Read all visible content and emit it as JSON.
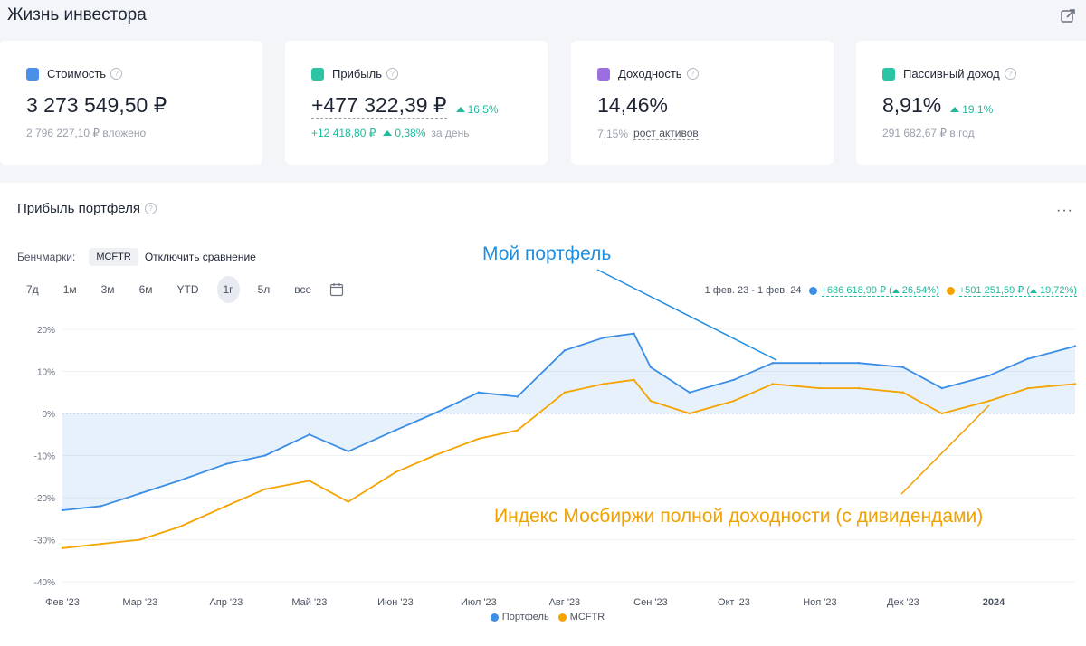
{
  "page_title": "Жизнь инвестора",
  "icons": {
    "share": "share-icon",
    "question": "?"
  },
  "cards": [
    {
      "label": "Стоимость",
      "value": "3 273 549,50 ₽",
      "change": "",
      "sub": "2 796 227,10 ₽ вложено",
      "sub_change": "",
      "sub_tail": "",
      "icon_color": "#4a8fe8"
    },
    {
      "label": "Прибыль",
      "value": "+477 322,39 ₽",
      "change": "16,5%",
      "sub": "+12 418,80 ₽",
      "sub_change": "0,38%",
      "sub_tail": "за день",
      "icon_color": "#2bc5a5"
    },
    {
      "label": "Доходность",
      "value": "14,46%",
      "change": "",
      "sub": "7,15%",
      "sub_change": "",
      "sub_tail": "рост активов",
      "icon_color": "#9b6fe0"
    },
    {
      "label": "Пассивный доход",
      "value": "8,91%",
      "change": "19,1%",
      "sub": "291 682,67 ₽ в год",
      "sub_change": "",
      "sub_tail": "",
      "icon_color": "#2bc5a5"
    }
  ],
  "chart_panel": {
    "title": "Прибыль портфеля",
    "benchmarks_label": "Бенчмарки:",
    "benchmark_chip": "MCFTR",
    "disable_compare": "Отключить сравнение",
    "periods": [
      "7д",
      "1м",
      "3м",
      "6м",
      "YTD",
      "1г",
      "5л",
      "все"
    ],
    "active_period": "1г",
    "range": "1 фев. 23 - 1 фев. 24",
    "portfolio_gain": "+686 618,99 ₽ (",
    "portfolio_pct": "26,54%)",
    "bench_gain": "+501 251,59 ₽ (",
    "bench_pct": "19,72%)",
    "annotation_portfolio": "Мой портфель",
    "annotation_index": "Индекс Мосбиржи полной доходности (с дивидендами)",
    "more_icon": "···"
  },
  "colors": {
    "portfolio": "#3b8ee6",
    "mcftr": "#f5a300",
    "green": "#1fb99b"
  },
  "chart_data": {
    "type": "line",
    "x_tick_labels": [
      "Фев '23",
      "Мар '23",
      "Апр '23",
      "Май '23",
      "Июн '23",
      "Июл '23",
      "Авг '23",
      "Сен '23",
      "Окт '23",
      "Ноя '23",
      "Дек '23",
      "2024"
    ],
    "y_tick_labels": [
      "20%",
      "10%",
      "0%",
      "-10%",
      "-20%",
      "-30%",
      "-40%"
    ],
    "ylim": [
      -40,
      20
    ],
    "grid": "y",
    "legend_position": "bottom",
    "series": [
      {
        "name": "Портфель",
        "color": "#3b8ee6",
        "x": [
          "2023-02-01",
          "2023-02-15",
          "2023-03-01",
          "2023-03-15",
          "2023-04-01",
          "2023-04-15",
          "2023-05-01",
          "2023-05-15",
          "2023-06-01",
          "2023-06-15",
          "2023-07-01",
          "2023-07-15",
          "2023-08-01",
          "2023-08-15",
          "2023-08-26",
          "2023-09-01",
          "2023-09-15",
          "2023-10-01",
          "2023-10-15",
          "2023-11-01",
          "2023-11-15",
          "2023-12-01",
          "2023-12-15",
          "2024-01-01",
          "2024-01-15",
          "2024-02-01"
        ],
        "y": [
          -23,
          -22,
          -19,
          -16,
          -12,
          -10,
          -5,
          -9,
          -4,
          0,
          5,
          4,
          15,
          18,
          19,
          11,
          5,
          8,
          12,
          12,
          12,
          11,
          6,
          9,
          13,
          16
        ]
      },
      {
        "name": "MCFTR",
        "color": "#f5a300",
        "x": [
          "2023-02-01",
          "2023-02-15",
          "2023-03-01",
          "2023-03-15",
          "2023-04-01",
          "2023-04-15",
          "2023-05-01",
          "2023-05-15",
          "2023-06-01",
          "2023-06-15",
          "2023-07-01",
          "2023-07-15",
          "2023-08-01",
          "2023-08-15",
          "2023-08-26",
          "2023-09-01",
          "2023-09-15",
          "2023-10-01",
          "2023-10-15",
          "2023-11-01",
          "2023-11-15",
          "2023-12-01",
          "2023-12-15",
          "2024-01-01",
          "2024-01-15",
          "2024-02-01"
        ],
        "y": [
          -32,
          -31,
          -30,
          -27,
          -22,
          -18,
          -16,
          -21,
          -14,
          -10,
          -6,
          -4,
          5,
          7,
          8,
          3,
          0,
          3,
          7,
          6,
          6,
          5,
          0,
          3,
          6,
          7
        ]
      }
    ]
  },
  "legend": [
    {
      "label": "Портфель"
    },
    {
      "label": "MCFTR"
    }
  ]
}
